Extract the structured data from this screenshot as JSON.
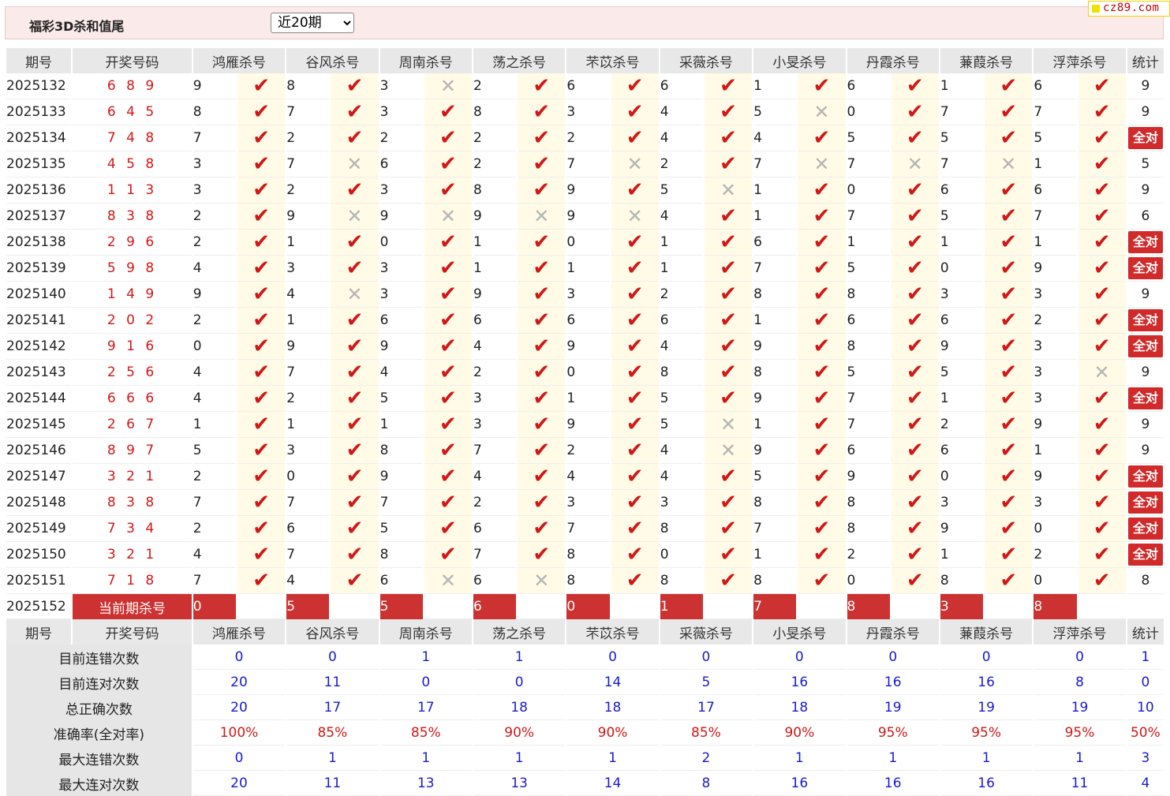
{
  "app": {
    "title": "福彩3D杀和值尾",
    "select_value": "近20期",
    "select_options": [
      "近20期"
    ],
    "logo": "cz89.com"
  },
  "table": {
    "header": {
      "period": "期号",
      "draw": "开奖号码",
      "stat": "统计"
    },
    "experts": [
      "鸿雁杀号",
      "谷风杀号",
      "周南杀号",
      "荡之杀号",
      "芣苡杀号",
      "采薇杀号",
      "小旻杀号",
      "丹霞杀号",
      "蒹葭杀号",
      "浮萍杀号"
    ],
    "rows": [
      {
        "period": "2025132",
        "draw": "6 8 9",
        "kills": [
          "9",
          "8",
          "3",
          "2",
          "6",
          "6",
          "1",
          "6",
          "1",
          "6"
        ],
        "ok": [
          1,
          1,
          0,
          1,
          1,
          1,
          1,
          1,
          1,
          1
        ],
        "stat": "9"
      },
      {
        "period": "2025133",
        "draw": "6 4 5",
        "kills": [
          "8",
          "7",
          "3",
          "8",
          "3",
          "4",
          "5",
          "0",
          "7",
          "7"
        ],
        "ok": [
          1,
          1,
          1,
          1,
          1,
          1,
          0,
          1,
          1,
          1
        ],
        "stat": "9"
      },
      {
        "period": "2025134",
        "draw": "7 4 8",
        "kills": [
          "7",
          "2",
          "2",
          "2",
          "2",
          "4",
          "4",
          "5",
          "5",
          "5"
        ],
        "ok": [
          1,
          1,
          1,
          1,
          1,
          1,
          1,
          1,
          1,
          1
        ],
        "stat": "全对"
      },
      {
        "period": "2025135",
        "draw": "4 5 8",
        "kills": [
          "3",
          "7",
          "6",
          "2",
          "7",
          "2",
          "7",
          "7",
          "7",
          "1"
        ],
        "ok": [
          1,
          0,
          1,
          1,
          0,
          1,
          0,
          0,
          0,
          1
        ],
        "stat": "5"
      },
      {
        "period": "2025136",
        "draw": "1 1 3",
        "kills": [
          "3",
          "2",
          "3",
          "8",
          "9",
          "5",
          "1",
          "0",
          "6",
          "6"
        ],
        "ok": [
          1,
          1,
          1,
          1,
          1,
          0,
          1,
          1,
          1,
          1
        ],
        "stat": "9"
      },
      {
        "period": "2025137",
        "draw": "8 3 8",
        "kills": [
          "2",
          "9",
          "9",
          "9",
          "9",
          "4",
          "1",
          "7",
          "5",
          "7"
        ],
        "ok": [
          1,
          0,
          0,
          0,
          0,
          1,
          1,
          1,
          1,
          1
        ],
        "stat": "6"
      },
      {
        "period": "2025138",
        "draw": "2 9 6",
        "kills": [
          "2",
          "1",
          "0",
          "1",
          "0",
          "1",
          "6",
          "1",
          "1",
          "1"
        ],
        "ok": [
          1,
          1,
          1,
          1,
          1,
          1,
          1,
          1,
          1,
          1
        ],
        "stat": "全对"
      },
      {
        "period": "2025139",
        "draw": "5 9 8",
        "kills": [
          "4",
          "3",
          "3",
          "1",
          "1",
          "1",
          "7",
          "5",
          "0",
          "9"
        ],
        "ok": [
          1,
          1,
          1,
          1,
          1,
          1,
          1,
          1,
          1,
          1
        ],
        "stat": "全对"
      },
      {
        "period": "2025140",
        "draw": "1 4 9",
        "kills": [
          "9",
          "4",
          "3",
          "9",
          "3",
          "2",
          "8",
          "8",
          "3",
          "3"
        ],
        "ok": [
          1,
          0,
          1,
          1,
          1,
          1,
          1,
          1,
          1,
          1
        ],
        "stat": "9"
      },
      {
        "period": "2025141",
        "draw": "2 0 2",
        "kills": [
          "2",
          "1",
          "6",
          "6",
          "6",
          "6",
          "1",
          "6",
          "6",
          "2"
        ],
        "ok": [
          1,
          1,
          1,
          1,
          1,
          1,
          1,
          1,
          1,
          1
        ],
        "stat": "全对"
      },
      {
        "period": "2025142",
        "draw": "9 1 6",
        "kills": [
          "0",
          "9",
          "9",
          "4",
          "9",
          "4",
          "9",
          "8",
          "9",
          "3"
        ],
        "ok": [
          1,
          1,
          1,
          1,
          1,
          1,
          1,
          1,
          1,
          1
        ],
        "stat": "全对"
      },
      {
        "period": "2025143",
        "draw": "2 5 6",
        "kills": [
          "4",
          "7",
          "4",
          "2",
          "0",
          "8",
          "8",
          "5",
          "5",
          "3"
        ],
        "ok": [
          1,
          1,
          1,
          1,
          1,
          1,
          1,
          1,
          1,
          0
        ],
        "stat": "9"
      },
      {
        "period": "2025144",
        "draw": "6 6 6",
        "kills": [
          "4",
          "2",
          "5",
          "3",
          "1",
          "5",
          "9",
          "7",
          "1",
          "3"
        ],
        "ok": [
          1,
          1,
          1,
          1,
          1,
          1,
          1,
          1,
          1,
          1
        ],
        "stat": "全对"
      },
      {
        "period": "2025145",
        "draw": "2 6 7",
        "kills": [
          "1",
          "1",
          "1",
          "3",
          "9",
          "5",
          "1",
          "7",
          "2",
          "9"
        ],
        "ok": [
          1,
          1,
          1,
          1,
          1,
          0,
          1,
          1,
          1,
          1
        ],
        "stat": "9"
      },
      {
        "period": "2025146",
        "draw": "8 9 7",
        "kills": [
          "5",
          "3",
          "8",
          "7",
          "2",
          "4",
          "9",
          "6",
          "6",
          "1"
        ],
        "ok": [
          1,
          1,
          1,
          1,
          1,
          0,
          1,
          1,
          1,
          1
        ],
        "stat": "9"
      },
      {
        "period": "2025147",
        "draw": "3 2 1",
        "kills": [
          "2",
          "0",
          "9",
          "4",
          "4",
          "4",
          "5",
          "9",
          "0",
          "9"
        ],
        "ok": [
          1,
          1,
          1,
          1,
          1,
          1,
          1,
          1,
          1,
          1
        ],
        "stat": "全对"
      },
      {
        "period": "2025148",
        "draw": "8 3 8",
        "kills": [
          "7",
          "7",
          "7",
          "2",
          "3",
          "3",
          "8",
          "8",
          "3",
          "3"
        ],
        "ok": [
          1,
          1,
          1,
          1,
          1,
          1,
          1,
          1,
          1,
          1
        ],
        "stat": "全对"
      },
      {
        "period": "2025149",
        "draw": "7 3 4",
        "kills": [
          "2",
          "6",
          "5",
          "6",
          "7",
          "8",
          "7",
          "8",
          "9",
          "0"
        ],
        "ok": [
          1,
          1,
          1,
          1,
          1,
          1,
          1,
          1,
          1,
          1
        ],
        "stat": "全对"
      },
      {
        "period": "2025150",
        "draw": "3 2 1",
        "kills": [
          "4",
          "7",
          "8",
          "7",
          "8",
          "0",
          "1",
          "2",
          "1",
          "2"
        ],
        "ok": [
          1,
          1,
          1,
          1,
          1,
          1,
          1,
          1,
          1,
          1
        ],
        "stat": "全对"
      },
      {
        "period": "2025151",
        "draw": "7 1 8",
        "kills": [
          "7",
          "4",
          "6",
          "6",
          "8",
          "8",
          "8",
          "0",
          "8",
          "0"
        ],
        "ok": [
          1,
          1,
          0,
          0,
          1,
          1,
          1,
          1,
          1,
          1
        ],
        "stat": "8"
      }
    ],
    "current": {
      "period": "2025152",
      "label": "当前期杀号",
      "kills": [
        "0",
        "5",
        "5",
        "6",
        "0",
        "1",
        "7",
        "8",
        "3",
        "8"
      ]
    },
    "summary": [
      {
        "label": "目前连错次数",
        "values": [
          "0",
          "0",
          "1",
          "1",
          "0",
          "0",
          "0",
          "0",
          "0",
          "0",
          "1"
        ],
        "red": false
      },
      {
        "label": "目前连对次数",
        "values": [
          "20",
          "11",
          "0",
          "0",
          "14",
          "5",
          "16",
          "16",
          "16",
          "8",
          "0"
        ],
        "red": false
      },
      {
        "label": "总正确次数",
        "values": [
          "20",
          "17",
          "17",
          "18",
          "18",
          "17",
          "18",
          "19",
          "19",
          "19",
          "10"
        ],
        "red": false
      },
      {
        "label": "准确率(全对率)",
        "values": [
          "100%",
          "85%",
          "85%",
          "90%",
          "90%",
          "85%",
          "90%",
          "95%",
          "95%",
          "95%",
          "50%"
        ],
        "red": true
      },
      {
        "label": "最大连错次数",
        "values": [
          "0",
          "1",
          "1",
          "1",
          "1",
          "2",
          "1",
          "1",
          "1",
          "1",
          "3"
        ],
        "red": false
      },
      {
        "label": "最大连对次数",
        "values": [
          "20",
          "11",
          "13",
          "13",
          "14",
          "8",
          "16",
          "16",
          "16",
          "11",
          "4"
        ],
        "red": false
      }
    ]
  },
  "icons": {
    "ok": "check-mark-icon",
    "no": "cross-mark-icon"
  },
  "colors": {
    "accent_red": "#d01818",
    "badge_red": "#d02a2a",
    "summary_blue": "#1a1ad0",
    "mark_bg": "#fffbe6",
    "header_bg": "#e8e8e8"
  }
}
